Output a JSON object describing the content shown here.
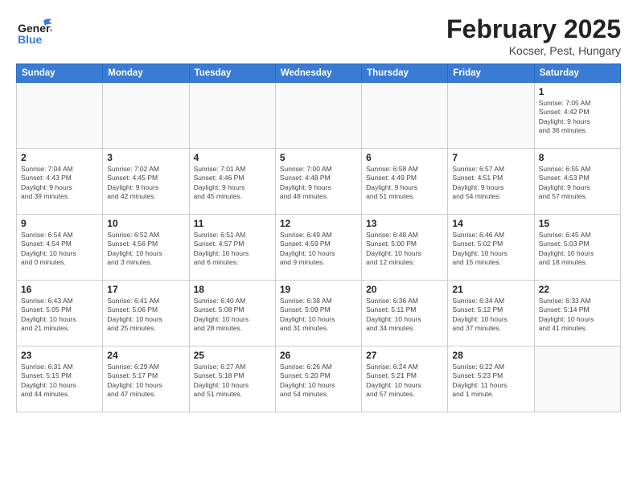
{
  "header": {
    "logo_general": "General",
    "logo_blue": "Blue",
    "month": "February 2025",
    "location": "Kocser, Pest, Hungary"
  },
  "weekdays": [
    "Sunday",
    "Monday",
    "Tuesday",
    "Wednesday",
    "Thursday",
    "Friday",
    "Saturday"
  ],
  "weeks": [
    [
      {
        "day": "",
        "info": ""
      },
      {
        "day": "",
        "info": ""
      },
      {
        "day": "",
        "info": ""
      },
      {
        "day": "",
        "info": ""
      },
      {
        "day": "",
        "info": ""
      },
      {
        "day": "",
        "info": ""
      },
      {
        "day": "1",
        "info": "Sunrise: 7:05 AM\nSunset: 4:42 PM\nDaylight: 9 hours\nand 36 minutes."
      }
    ],
    [
      {
        "day": "2",
        "info": "Sunrise: 7:04 AM\nSunset: 4:43 PM\nDaylight: 9 hours\nand 39 minutes."
      },
      {
        "day": "3",
        "info": "Sunrise: 7:02 AM\nSunset: 4:45 PM\nDaylight: 9 hours\nand 42 minutes."
      },
      {
        "day": "4",
        "info": "Sunrise: 7:01 AM\nSunset: 4:46 PM\nDaylight: 9 hours\nand 45 minutes."
      },
      {
        "day": "5",
        "info": "Sunrise: 7:00 AM\nSunset: 4:48 PM\nDaylight: 9 hours\nand 48 minutes."
      },
      {
        "day": "6",
        "info": "Sunrise: 6:58 AM\nSunset: 4:49 PM\nDaylight: 9 hours\nand 51 minutes."
      },
      {
        "day": "7",
        "info": "Sunrise: 6:57 AM\nSunset: 4:51 PM\nDaylight: 9 hours\nand 54 minutes."
      },
      {
        "day": "8",
        "info": "Sunrise: 6:55 AM\nSunset: 4:53 PM\nDaylight: 9 hours\nand 57 minutes."
      }
    ],
    [
      {
        "day": "9",
        "info": "Sunrise: 6:54 AM\nSunset: 4:54 PM\nDaylight: 10 hours\nand 0 minutes."
      },
      {
        "day": "10",
        "info": "Sunrise: 6:52 AM\nSunset: 4:56 PM\nDaylight: 10 hours\nand 3 minutes."
      },
      {
        "day": "11",
        "info": "Sunrise: 6:51 AM\nSunset: 4:57 PM\nDaylight: 10 hours\nand 6 minutes."
      },
      {
        "day": "12",
        "info": "Sunrise: 6:49 AM\nSunset: 4:59 PM\nDaylight: 10 hours\nand 9 minutes."
      },
      {
        "day": "13",
        "info": "Sunrise: 6:48 AM\nSunset: 5:00 PM\nDaylight: 10 hours\nand 12 minutes."
      },
      {
        "day": "14",
        "info": "Sunrise: 6:46 AM\nSunset: 5:02 PM\nDaylight: 10 hours\nand 15 minutes."
      },
      {
        "day": "15",
        "info": "Sunrise: 6:45 AM\nSunset: 5:03 PM\nDaylight: 10 hours\nand 18 minutes."
      }
    ],
    [
      {
        "day": "16",
        "info": "Sunrise: 6:43 AM\nSunset: 5:05 PM\nDaylight: 10 hours\nand 21 minutes."
      },
      {
        "day": "17",
        "info": "Sunrise: 6:41 AM\nSunset: 5:06 PM\nDaylight: 10 hours\nand 25 minutes."
      },
      {
        "day": "18",
        "info": "Sunrise: 6:40 AM\nSunset: 5:08 PM\nDaylight: 10 hours\nand 28 minutes."
      },
      {
        "day": "19",
        "info": "Sunrise: 6:38 AM\nSunset: 5:09 PM\nDaylight: 10 hours\nand 31 minutes."
      },
      {
        "day": "20",
        "info": "Sunrise: 6:36 AM\nSunset: 5:11 PM\nDaylight: 10 hours\nand 34 minutes."
      },
      {
        "day": "21",
        "info": "Sunrise: 6:34 AM\nSunset: 5:12 PM\nDaylight: 10 hours\nand 37 minutes."
      },
      {
        "day": "22",
        "info": "Sunrise: 6:33 AM\nSunset: 5:14 PM\nDaylight: 10 hours\nand 41 minutes."
      }
    ],
    [
      {
        "day": "23",
        "info": "Sunrise: 6:31 AM\nSunset: 5:15 PM\nDaylight: 10 hours\nand 44 minutes."
      },
      {
        "day": "24",
        "info": "Sunrise: 6:29 AM\nSunset: 5:17 PM\nDaylight: 10 hours\nand 47 minutes."
      },
      {
        "day": "25",
        "info": "Sunrise: 6:27 AM\nSunset: 5:18 PM\nDaylight: 10 hours\nand 51 minutes."
      },
      {
        "day": "26",
        "info": "Sunrise: 6:26 AM\nSunset: 5:20 PM\nDaylight: 10 hours\nand 54 minutes."
      },
      {
        "day": "27",
        "info": "Sunrise: 6:24 AM\nSunset: 5:21 PM\nDaylight: 10 hours\nand 57 minutes."
      },
      {
        "day": "28",
        "info": "Sunrise: 6:22 AM\nSunset: 5:23 PM\nDaylight: 11 hours\nand 1 minute."
      },
      {
        "day": "",
        "info": ""
      }
    ]
  ]
}
